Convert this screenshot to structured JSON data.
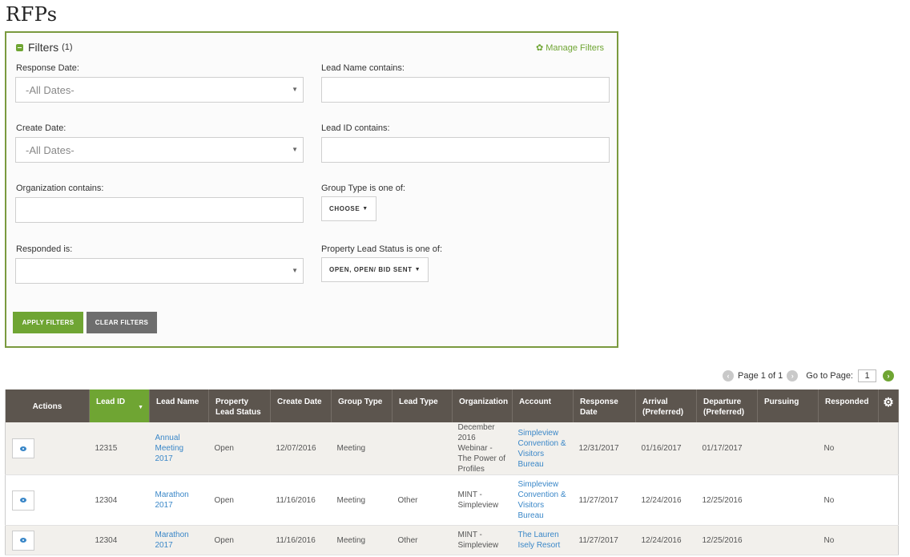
{
  "page": {
    "title": "RFPs"
  },
  "filters": {
    "title": "Filters",
    "count": "(1)",
    "manage_label": "Manage Filters",
    "response_date": {
      "label": "Response Date:",
      "value": "-All Dates-"
    },
    "lead_name": {
      "label": "Lead Name contains:",
      "value": ""
    },
    "create_date": {
      "label": "Create Date:",
      "value": "-All Dates-"
    },
    "lead_id": {
      "label": "Lead ID contains:",
      "value": ""
    },
    "organization": {
      "label": "Organization contains:",
      "value": ""
    },
    "group_type": {
      "label": "Group Type is one of:",
      "value": "CHOOSE"
    },
    "responded": {
      "label": "Responded is:",
      "value": ""
    },
    "property_lead_status": {
      "label": "Property Lead Status is one of:",
      "value": "OPEN, OPEN/ BID SENT"
    },
    "apply_label": "APPLY FILTERS",
    "clear_label": "CLEAR FILTERS"
  },
  "pagination": {
    "page_text": "Page 1 of 1",
    "goto_label": "Go to Page:",
    "goto_value": "1"
  },
  "table": {
    "columns": [
      "Actions",
      "Lead ID",
      "Lead Name",
      "Property Lead Status",
      "Create Date",
      "Group Type",
      "Lead Type",
      "Organization",
      "Account",
      "Response Date",
      "Arrival (Preferred)",
      "Departure (Preferred)",
      "Pursuing",
      "Responded"
    ],
    "sorted_column": "Lead ID",
    "rows": [
      {
        "lead_id": "12315",
        "lead_name": "Annual Meeting 2017",
        "status": "Open",
        "create_date": "12/07/2016",
        "group_type": "Meeting",
        "lead_type": "",
        "organization": "December 2016 Webinar - The Power of Profiles",
        "account": "Simpleview Convention & Visitors Bureau",
        "response_date": "12/31/2017",
        "arrival": "01/16/2017",
        "departure": "01/17/2017",
        "pursuing": "",
        "responded": "No"
      },
      {
        "lead_id": "12304",
        "lead_name": "Marathon 2017",
        "status": "Open",
        "create_date": "11/16/2016",
        "group_type": "Meeting",
        "lead_type": "Other",
        "organization": "MINT - Simpleview",
        "account": "Simpleview Convention & Visitors Bureau",
        "response_date": "11/27/2017",
        "arrival": "12/24/2016",
        "departure": "12/25/2016",
        "pursuing": "",
        "responded": "No"
      },
      {
        "lead_id": "12304",
        "lead_name": "Marathon 2017",
        "status": "Open",
        "create_date": "11/16/2016",
        "group_type": "Meeting",
        "lead_type": "Other",
        "organization": "MINT - Simpleview",
        "account": "The Lauren Isely Resort",
        "response_date": "11/27/2017",
        "arrival": "12/24/2016",
        "departure": "12/25/2016",
        "pursuing": "",
        "responded": "No"
      }
    ]
  },
  "colors": {
    "accent": "#6fa533",
    "header_bg": "#5c554e",
    "link": "#3a87c8",
    "panel_border": "#7a9a3f"
  }
}
